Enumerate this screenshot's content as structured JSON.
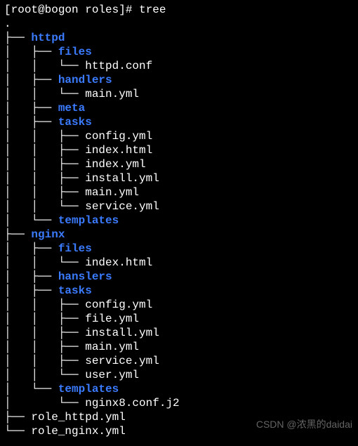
{
  "prompt": {
    "user": "root",
    "host": "bogon",
    "cwd": "roles",
    "symbol": "#",
    "command": "tree"
  },
  "tree": {
    "root": ".",
    "lines": [
      {
        "prefix": "├── ",
        "name": "httpd",
        "type": "dir"
      },
      {
        "prefix": "│   ├── ",
        "name": "files",
        "type": "dir"
      },
      {
        "prefix": "│   │   └── ",
        "name": "httpd.conf",
        "type": "file"
      },
      {
        "prefix": "│   ├── ",
        "name": "handlers",
        "type": "dir"
      },
      {
        "prefix": "│   │   └── ",
        "name": "main.yml",
        "type": "file"
      },
      {
        "prefix": "│   ├── ",
        "name": "meta",
        "type": "dir"
      },
      {
        "prefix": "│   ├── ",
        "name": "tasks",
        "type": "dir"
      },
      {
        "prefix": "│   │   ├── ",
        "name": "config.yml",
        "type": "file"
      },
      {
        "prefix": "│   │   ├── ",
        "name": "index.html",
        "type": "file"
      },
      {
        "prefix": "│   │   ├── ",
        "name": "index.yml",
        "type": "file"
      },
      {
        "prefix": "│   │   ├── ",
        "name": "install.yml",
        "type": "file"
      },
      {
        "prefix": "│   │   ├── ",
        "name": "main.yml",
        "type": "file"
      },
      {
        "prefix": "│   │   └── ",
        "name": "service.yml",
        "type": "file"
      },
      {
        "prefix": "│   └── ",
        "name": "templates",
        "type": "dir"
      },
      {
        "prefix": "├── ",
        "name": "nginx",
        "type": "dir"
      },
      {
        "prefix": "│   ├── ",
        "name": "files",
        "type": "dir"
      },
      {
        "prefix": "│   │   └── ",
        "name": "index.html",
        "type": "file"
      },
      {
        "prefix": "│   ├── ",
        "name": "hanslers",
        "type": "dir"
      },
      {
        "prefix": "│   ├── ",
        "name": "tasks",
        "type": "dir"
      },
      {
        "prefix": "│   │   ├── ",
        "name": "config.yml",
        "type": "file"
      },
      {
        "prefix": "│   │   ├── ",
        "name": "file.yml",
        "type": "file"
      },
      {
        "prefix": "│   │   ├── ",
        "name": "install.yml",
        "type": "file"
      },
      {
        "prefix": "│   │   ├── ",
        "name": "main.yml",
        "type": "file"
      },
      {
        "prefix": "│   │   ├── ",
        "name": "service.yml",
        "type": "file"
      },
      {
        "prefix": "│   │   └── ",
        "name": "user.yml",
        "type": "file"
      },
      {
        "prefix": "│   └── ",
        "name": "templates",
        "type": "dir"
      },
      {
        "prefix": "│       └── ",
        "name": "nginx8.conf.j2",
        "type": "file"
      },
      {
        "prefix": "├── ",
        "name": "role_httpd.yml",
        "type": "file"
      },
      {
        "prefix": "└── ",
        "name": "role_nginx.yml",
        "type": "file"
      }
    ]
  },
  "watermark": "CSDN @浓黑的daidai"
}
